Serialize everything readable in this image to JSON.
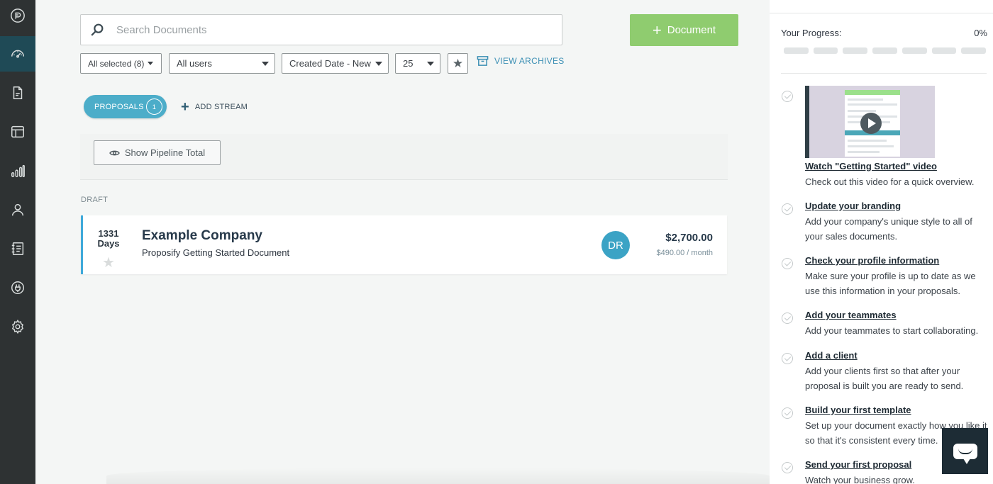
{
  "search": {
    "placeholder": "Search Documents"
  },
  "toolbar": {
    "add_document_label": "Document",
    "filters": {
      "status": "All selected (8)",
      "users": "All users",
      "sort": "Created Date - New",
      "per_page": "25"
    },
    "view_archives_label": "VIEW ARCHIVES"
  },
  "streams": {
    "active": {
      "label": "PROPOSALS",
      "count": "1"
    },
    "add_label": "ADD STREAM"
  },
  "pipeline": {
    "show_total_label": "Show Pipeline Total"
  },
  "documents": {
    "section_label": "DRAFT",
    "items": [
      {
        "days_count": "1331",
        "days_unit": "Days",
        "company": "Example Company",
        "name": "Proposify Getting Started Document",
        "owner_initials": "DR",
        "amount": "$2,700.00",
        "monthly": "$490.00 / month"
      }
    ]
  },
  "onboarding": {
    "progress_label": "Your Progress:",
    "progress_value": "0%",
    "progress_fraction": 0,
    "tasks": [
      {
        "title": "Watch \"Getting Started\" video",
        "desc": "Check out this video for a quick overview."
      },
      {
        "title": "Update your branding",
        "desc": "Add your company's unique style to all of your sales documents."
      },
      {
        "title": "Check your profile information",
        "desc": "Make sure your profile is up to date as we use this information in your proposals."
      },
      {
        "title": "Add your teammates",
        "desc": "Add your teammates to start collaborating."
      },
      {
        "title": "Add a client",
        "desc": "Add your clients first so that after your proposal is built you are ready to send."
      },
      {
        "title": "Build your first template",
        "desc": "Set up your document exactly how you like it so that it's consistent every time."
      },
      {
        "title": "Send your first proposal",
        "desc": "Watch your business grow."
      }
    ]
  },
  "nav": {
    "items": [
      "logo-icon",
      "dashboard-icon",
      "documents-icon",
      "templates-icon",
      "reports-icon",
      "contacts-icon",
      "content-library-icon",
      "integrations-icon",
      "settings-icon"
    ],
    "active": "dashboard-icon"
  },
  "colors": {
    "accent_green": "#8fcc6f",
    "accent_blue": "#4cadc9",
    "nav_bg": "#2e3233",
    "chat_bg": "#1d2c35"
  }
}
